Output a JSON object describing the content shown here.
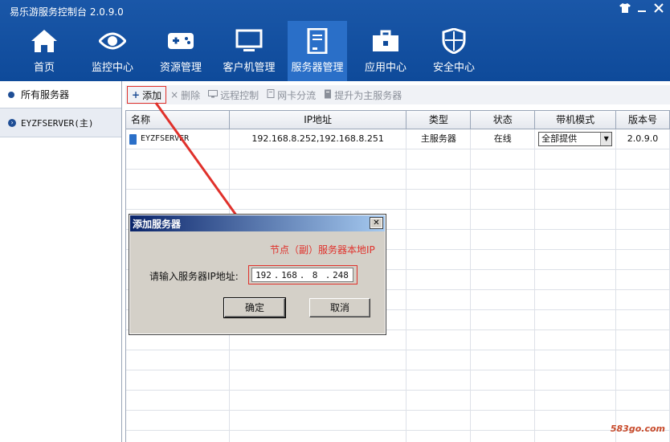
{
  "window": {
    "title": "易乐游服务控制台 2.0.9.0",
    "controls": [
      "shirt-icon",
      "minimize-icon",
      "close-icon"
    ]
  },
  "nav": {
    "items": [
      {
        "label": "首页",
        "icon": "home-icon",
        "active": false
      },
      {
        "label": "监控中心",
        "icon": "eye-icon",
        "active": false
      },
      {
        "label": "资源管理",
        "icon": "gamepad-icon",
        "active": false
      },
      {
        "label": "客户机管理",
        "icon": "monitor-icon",
        "active": false
      },
      {
        "label": "服务器管理",
        "icon": "server-icon",
        "active": true
      },
      {
        "label": "应用中心",
        "icon": "toolbox-icon",
        "active": false
      },
      {
        "label": "安全中心",
        "icon": "shield-icon",
        "active": false
      }
    ]
  },
  "sidebar": {
    "all_label": "所有服务器",
    "server_label": "EYZFSERVER(主)"
  },
  "toolbar": {
    "add": "添加",
    "delete": "删除",
    "remote": "远程控制",
    "nic": "网卡分流",
    "promote": "提升为主服务器"
  },
  "table": {
    "headers": [
      "名称",
      "IP地址",
      "类型",
      "状态",
      "带机模式",
      "版本号"
    ],
    "rows": [
      {
        "name": "EYZFSERVER",
        "ip": "192.168.8.252,192.168.8.251",
        "type": "主服务器",
        "status": "在线",
        "mode": "全部提供",
        "version": "2.0.9.0"
      }
    ]
  },
  "dialog": {
    "title": "添加服务器",
    "label": "请输入服务器IP地址:",
    "ip": [
      "192",
      "168",
      "8",
      "248"
    ],
    "ok": "确定",
    "cancel": "取消"
  },
  "annotation": {
    "text": "节点（副）服务器本地IP",
    "color": "#e0312b"
  },
  "watermark": "583go.com",
  "colors": {
    "header_blue": "#0e4a9a",
    "active_nav": "#2a6fc8",
    "highlight_red": "#e0312b"
  }
}
